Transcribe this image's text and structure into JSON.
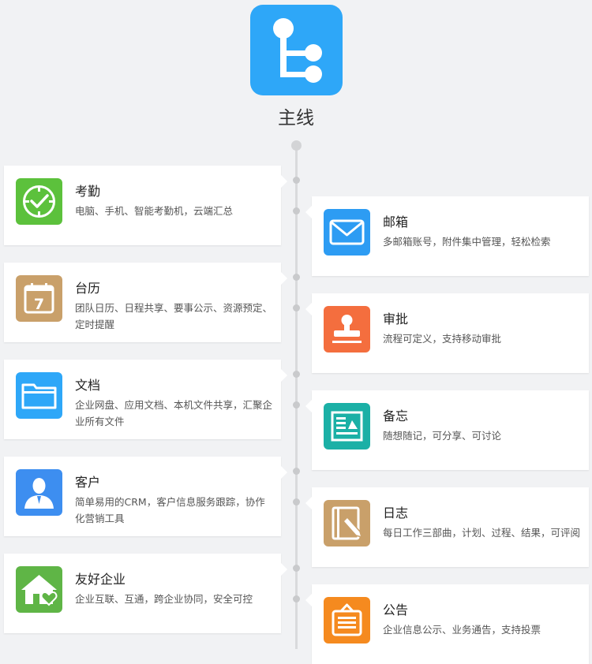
{
  "header": {
    "title": "主线"
  },
  "cards": [
    {
      "key": "attendance",
      "title": "考勤",
      "desc": "电脑、手机、智能考勤机，云端汇总",
      "color": "#5cc13c",
      "icon": "clock-check-icon"
    },
    {
      "key": "mail",
      "title": "邮箱",
      "desc": "多邮箱账号，附件集中管理，轻松检索",
      "color": "#2d9cf3",
      "icon": "envelope-icon"
    },
    {
      "key": "calendar",
      "title": "台历",
      "desc": "团队日历、日程共享、要事公示、资源预定、定时提醒",
      "color": "#c9a06a",
      "icon": "calendar-icon",
      "calendar_day": "7"
    },
    {
      "key": "approval",
      "title": "审批",
      "desc": "流程可定义，支持移动审批",
      "color": "#f46e3e",
      "icon": "stamp-icon"
    },
    {
      "key": "documents",
      "title": "文档",
      "desc": "企业网盘、应用文档、本机文件共享，汇聚企业所有文件",
      "color": "#2ea7f8",
      "icon": "folder-icon"
    },
    {
      "key": "memo",
      "title": "备忘",
      "desc": "随想随记，可分享、可讨论",
      "color": "#1bb0a6",
      "icon": "memo-icon"
    },
    {
      "key": "customer",
      "title": "客户",
      "desc": "简单易用的CRM，客户信息服务跟踪，协作化营销工具",
      "color": "#3d8ef0",
      "icon": "person-icon"
    },
    {
      "key": "log",
      "title": "日志",
      "desc": "每日工作三部曲，计划、过程、结果，可评阅",
      "color": "#c9a06a",
      "icon": "notebook-pen-icon"
    },
    {
      "key": "partner",
      "title": "友好企业",
      "desc": "企业互联、互通，跨企业协同，安全可控",
      "color": "#5fb546",
      "icon": "house-heart-icon"
    },
    {
      "key": "notice",
      "title": "公告",
      "desc": "企业信息公示、业务通告，支持投票",
      "color": "#f58a1f",
      "icon": "notice-board-icon"
    }
  ]
}
